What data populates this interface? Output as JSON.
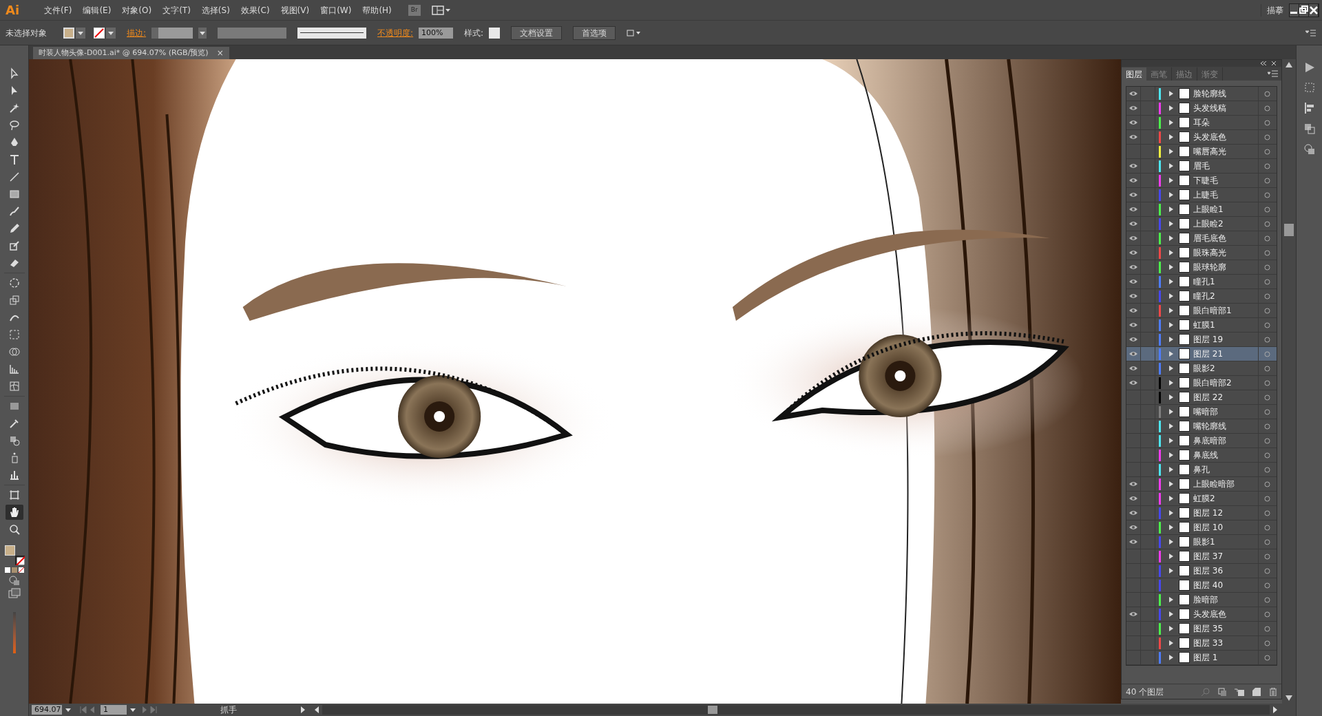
{
  "menu_bar": {
    "logo": "Ai",
    "menus": [
      "文件(F)",
      "编辑(E)",
      "对象(O)",
      "文字(T)",
      "选择(S)",
      "效果(C)",
      "视图(V)",
      "窗口(W)",
      "帮助(H)"
    ],
    "bridge_button": "Br",
    "workspace": "描摹"
  },
  "control_bar": {
    "selection": "未选择对象",
    "stroke_label": "描边:",
    "opacity_label": "不透明度:",
    "opacity_value": "100%",
    "style_label": "样式:",
    "buttons": [
      "文档设置",
      "首选项"
    ]
  },
  "document_tab": {
    "title": "时装人物头像-D001.ai* @ 694.07% (RGB/预览)",
    "close_glyph": "×"
  },
  "toolbar": {
    "tools": [
      {
        "selected": false
      },
      {
        "selected": false
      },
      {
        "selected": false
      },
      {
        "selected": false
      },
      {
        "selected": false
      },
      {
        "selected": false
      },
      {
        "selected": false
      },
      {
        "selected": false
      },
      {
        "selected": false
      },
      {
        "selected": false
      },
      {
        "selected": false
      },
      {
        "selected": false
      },
      {
        "selected": false
      },
      {
        "selected": false
      },
      {
        "selected": false
      },
      {
        "selected": false
      },
      {
        "selected": false
      },
      {
        "selected": false
      },
      {
        "selected": false
      },
      {
        "selected": false
      },
      {
        "selected": false
      },
      {
        "selected": false
      },
      {
        "selected": false
      },
      {
        "selected": false
      },
      {
        "selected": false
      },
      {
        "selected": true
      },
      {
        "selected": false
      }
    ]
  },
  "layers_panel": {
    "tabs": [
      {
        "label": "图层",
        "selected": true
      },
      {
        "label": "画笔",
        "selected": false
      },
      {
        "label": "描边",
        "selected": false
      },
      {
        "label": "渐变",
        "selected": false
      }
    ],
    "layers": [
      {
        "name": "脸轮廓线",
        "visible": true,
        "color": "#4ee6f0",
        "expandable": true,
        "selected": false
      },
      {
        "name": "头发线稿",
        "visible": true,
        "color": "#f03cf0",
        "expandable": true,
        "selected": false
      },
      {
        "name": "耳朵",
        "visible": true,
        "color": "#4cf04c",
        "expandable": true,
        "selected": false
      },
      {
        "name": "头发底色",
        "visible": true,
        "color": "#f04848",
        "expandable": true,
        "selected": false
      },
      {
        "name": "嘴唇高光",
        "visible": false,
        "color": "#f0f040",
        "expandable": true,
        "selected": false
      },
      {
        "name": "眉毛",
        "visible": true,
        "color": "#4ee6f0",
        "expandable": true,
        "selected": false
      },
      {
        "name": "下睫毛",
        "visible": true,
        "color": "#f03cf0",
        "expandable": true,
        "selected": false
      },
      {
        "name": "上睫毛",
        "visible": true,
        "color": "#4848f0",
        "expandable": true,
        "selected": false
      },
      {
        "name": "上眼睑1",
        "visible": true,
        "color": "#4cf04c",
        "expandable": true,
        "selected": false
      },
      {
        "name": "上眼睑2",
        "visible": true,
        "color": "#4848f0",
        "expandable": true,
        "selected": false
      },
      {
        "name": "眉毛底色",
        "visible": true,
        "color": "#4cf04c",
        "expandable": true,
        "selected": false
      },
      {
        "name": "眼珠高光",
        "visible": true,
        "color": "#f04848",
        "expandable": true,
        "selected": false
      },
      {
        "name": "眼球轮廓",
        "visible": true,
        "color": "#4cf04c",
        "expandable": true,
        "selected": false
      },
      {
        "name": "瞳孔1",
        "visible": true,
        "color": "#4f7dff",
        "expandable": true,
        "selected": false
      },
      {
        "name": "瞳孔2",
        "visible": true,
        "color": "#4848f0",
        "expandable": true,
        "selected": false
      },
      {
        "name": "眼白暗部1",
        "visible": true,
        "color": "#f04848",
        "expandable": true,
        "selected": false
      },
      {
        "name": "虹膜1",
        "visible": true,
        "color": "#4f7dff",
        "expandable": true,
        "selected": false
      },
      {
        "name": "图层 19",
        "visible": true,
        "color": "#4f7dff",
        "expandable": true,
        "selected": false
      },
      {
        "name": "图层 21",
        "visible": true,
        "color": "#4f7dff",
        "expandable": true,
        "selected": true
      },
      {
        "name": "眼影2",
        "visible": true,
        "color": "#4f7dff",
        "expandable": true,
        "selected": false
      },
      {
        "name": "眼白暗部2",
        "visible": true,
        "color": "#000000",
        "expandable": true,
        "selected": false
      },
      {
        "name": "图层 22",
        "visible": false,
        "color": "#000000",
        "expandable": true,
        "selected": false
      },
      {
        "name": "嘴暗部",
        "visible": false,
        "color": "#808080",
        "expandable": true,
        "selected": false
      },
      {
        "name": "嘴轮廓线",
        "visible": false,
        "color": "#4ee6f0",
        "expandable": true,
        "selected": false
      },
      {
        "name": "鼻底暗部",
        "visible": false,
        "color": "#4ee6f0",
        "expandable": true,
        "selected": false
      },
      {
        "name": "鼻底线",
        "visible": false,
        "color": "#f03cf0",
        "expandable": true,
        "selected": false
      },
      {
        "name": "鼻孔",
        "visible": false,
        "color": "#4ee6f0",
        "expandable": true,
        "selected": false
      },
      {
        "name": "上眼睑暗部",
        "visible": true,
        "color": "#f03cf0",
        "expandable": true,
        "selected": false
      },
      {
        "name": "虹膜2",
        "visible": true,
        "color": "#f03cf0",
        "expandable": true,
        "selected": false
      },
      {
        "name": "图层 12",
        "visible": true,
        "color": "#4848f0",
        "expandable": true,
        "selected": false
      },
      {
        "name": "图层 10",
        "visible": true,
        "color": "#4cf04c",
        "expandable": true,
        "selected": false
      },
      {
        "name": "眼影1",
        "visible": true,
        "color": "#4848f0",
        "expandable": true,
        "selected": false
      },
      {
        "name": "图层 37",
        "visible": false,
        "color": "#f03cf0",
        "expandable": true,
        "selected": false
      },
      {
        "name": "图层 36",
        "visible": false,
        "color": "#4848f0",
        "expandable": true,
        "selected": false
      },
      {
        "name": "图层 40",
        "visible": false,
        "color": "#4848f0",
        "expandable": false,
        "selected": false
      },
      {
        "name": "脸暗部",
        "visible": false,
        "color": "#4cf04c",
        "expandable": true,
        "selected": false
      },
      {
        "name": "头发底色",
        "visible": true,
        "color": "#4848f0",
        "expandable": true,
        "selected": false
      },
      {
        "name": "图层 35",
        "visible": false,
        "color": "#4cf04c",
        "expandable": true,
        "selected": false
      },
      {
        "name": "图层 33",
        "visible": false,
        "color": "#f04848",
        "expandable": true,
        "selected": false
      },
      {
        "name": "图层 1",
        "visible": false,
        "color": "#4f7dff",
        "expandable": true,
        "selected": false
      }
    ],
    "footer": "40 个图层"
  },
  "status_bar": {
    "zoom": "694.07",
    "artboard": "1",
    "tool": "抓手"
  }
}
